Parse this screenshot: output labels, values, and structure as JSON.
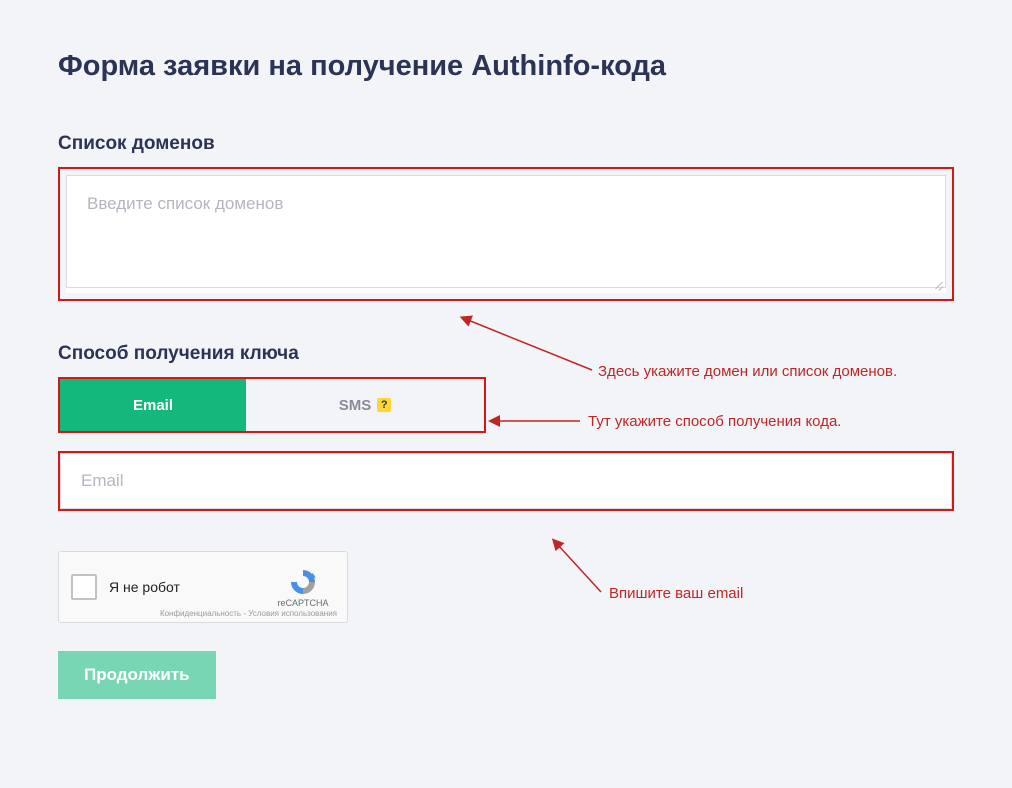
{
  "title": "Форма заявки на получение Authinfo-кода",
  "domains": {
    "label": "Список доменов",
    "placeholder": "Введите список доменов"
  },
  "method": {
    "label": "Способ получения ключа",
    "tabs": {
      "email": "Email",
      "sms": "SMS"
    },
    "help": "?"
  },
  "emailField": {
    "placeholder": "Email"
  },
  "recaptcha": {
    "label": "Я не робот",
    "brand": "reCAPTCHA",
    "privacy": "Конфиденциальность",
    "dash": " - ",
    "terms": "Условия использования"
  },
  "submit": "Продолжить",
  "annotations": {
    "domains": "Здесь укажите домен или список доменов.",
    "method": "Тут укажите способ получения кода.",
    "email": "Впишите ваш email"
  }
}
